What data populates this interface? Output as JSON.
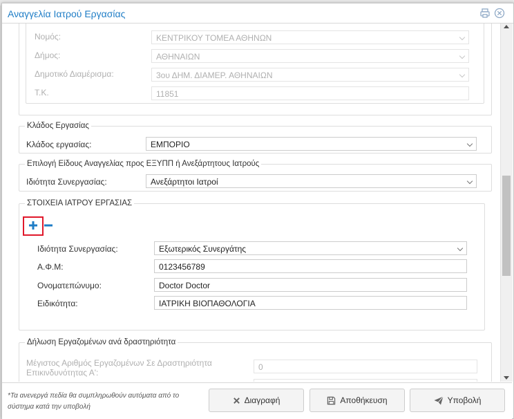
{
  "dialog": {
    "title": "Αναγγελία Ιατρού Εργασίας"
  },
  "address": {
    "rows": [
      {
        "label": "Νομός:",
        "value": "ΚΕΝΤΡΙΚΟΥ ΤΟΜΕΑ ΑΘΗΝΩΝ"
      },
      {
        "label": "Δήμος:",
        "value": "ΑΘΗΝΑΙΩΝ"
      },
      {
        "label": "Δημοτικό Διαμέρισμα:",
        "value": "3ου ΔΗΜ. ΔΙΑΜΕΡ. ΑΘΗΝΑΙΩΝ"
      },
      {
        "label": "Τ.Κ.",
        "value": "11851"
      }
    ]
  },
  "sector": {
    "legend": "Κλάδος Εργασίας",
    "label": "Κλάδος εργασίας:",
    "value": "ΕΜΠΟΡΙΟ"
  },
  "announcement_type": {
    "legend": "Επιλογή Είδους Αναγγελίας προς ΕΞΥΠΠ ή Ανεξάρτητους Ιατρούς",
    "label": "Ιδιότητα Συνεργασίας:",
    "value": "Ανεξάρτητοι Ιατροί"
  },
  "doctor": {
    "legend": "ΣΤΟΙΧΕΙΑ ΙΑΤΡΟΥ ΕΡΓΑΣΙΑΣ",
    "cooperation_label": "Ιδιότητα Συνεργασίας:",
    "cooperation_value": "Εξωτερικός Συνεργάτης",
    "afm_label": "Α.Φ.Μ:",
    "afm_value": "0123456789",
    "name_label": "Ονοματεπώνυμο:",
    "name_value": "Doctor Doctor",
    "specialty_label": "Ειδικότητα:",
    "specialty_value": "ΙΑΤΡΙΚΗ ΒΙΟΠΑΘΟΛΟΓΙΑ"
  },
  "employees": {
    "legend": "Δήλωση Εργαζομένων ανά δραστηριότητα",
    "max_label": "Μέγιστος Αριθμός Εργαζομένων Σε Δραστηριότητα Επικινδυνότητας Α':",
    "max_value": "0"
  },
  "footer": {
    "note": "*Τα ανενεργά πεδία θα συμπληρωθούν αυτόματα από το σύστημα κατά την υποβολή",
    "delete_label": "Διαγραφή",
    "save_label": "Αποθήκευση",
    "submit_label": "Υποβολή"
  },
  "colors": {
    "accent": "#1f7dc6",
    "highlight": "#e0182b"
  }
}
